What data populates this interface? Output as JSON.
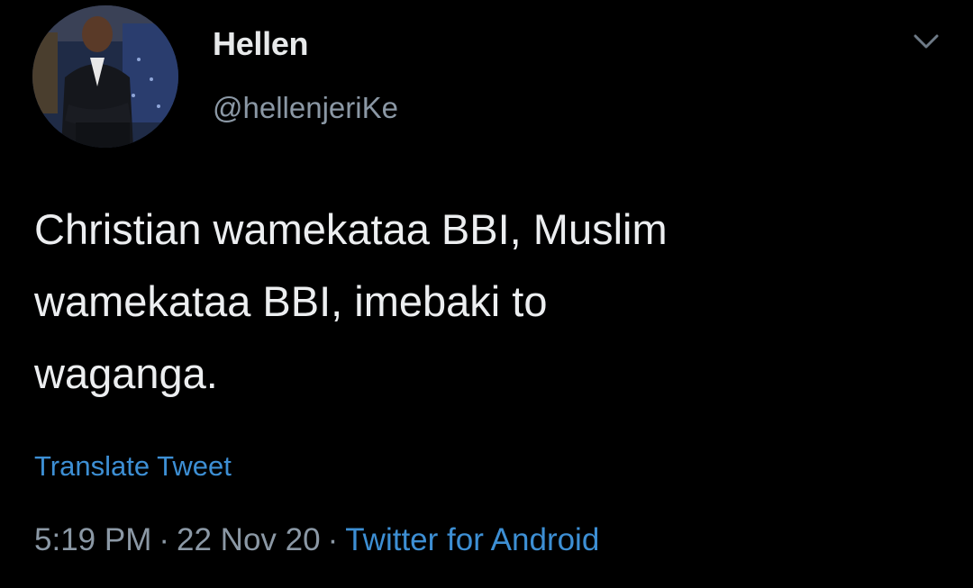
{
  "tweet": {
    "author": {
      "display_name": "Hellen",
      "handle": "@hellenjeriKe",
      "avatar_icon": "user-avatar-photo"
    },
    "menu_icon": "chevron-down-icon",
    "text": "Christian wamekataa BBI, Muslim\nwamekataa BBI, imebaki to\nwaganga.",
    "translate_label": "Translate Tweet",
    "time": "5:19 PM",
    "separator": "·",
    "date": "22 Nov 20",
    "source": "Twitter for Android"
  },
  "colors": {
    "background": "#000000",
    "text_primary": "#e7e9ea",
    "text_secondary": "#8b98a5",
    "link": "#3d8fd4"
  }
}
